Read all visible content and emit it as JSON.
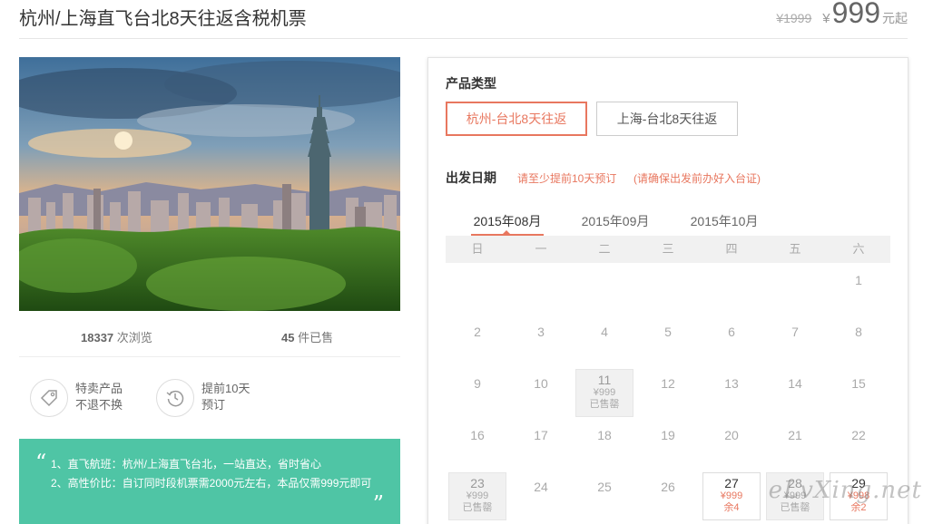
{
  "product": {
    "title": "杭州/上海直飞台北8天往返含税机票",
    "old_price": "¥1999",
    "currency": "¥",
    "price": "999",
    "price_suffix": "元起"
  },
  "stats": {
    "views_count": "18337",
    "views_label": "次浏览",
    "sold_count": "45",
    "sold_label": "件已售"
  },
  "features": [
    {
      "icon": "tag-icon",
      "text": "特卖产品不退不换"
    },
    {
      "icon": "clock-history-icon",
      "text": "提前10天预订"
    }
  ],
  "highlights": {
    "open_quote": "“",
    "close_quote": "”",
    "line1": "1、直飞航班：杭州/上海直飞台北，一站直达，省时省心",
    "line2": "2、高性价比：自订同时段机票需2000元左右，本品仅需999元即可"
  },
  "booking": {
    "type_label": "产品类型",
    "types": [
      "杭州-台北8天往返",
      "上海-台北8天往返"
    ],
    "selected_type": 0,
    "date_label": "出发日期",
    "hint1": "请至少提前10天预订",
    "hint2": "(请确保出发前办好入台证)",
    "months": [
      "2015年08月",
      "2015年09月",
      "2015年10月"
    ],
    "selected_month": 0,
    "weekdays": [
      "日",
      "一",
      "二",
      "三",
      "四",
      "五",
      "六"
    ],
    "calendar": [
      {
        "day": "1",
        "col": 6,
        "row": 0
      },
      {
        "day": "2",
        "col": 0,
        "row": 1
      },
      {
        "day": "3",
        "col": 1,
        "row": 1
      },
      {
        "day": "4",
        "col": 2,
        "row": 1
      },
      {
        "day": "5",
        "col": 3,
        "row": 1
      },
      {
        "day": "6",
        "col": 4,
        "row": 1
      },
      {
        "day": "7",
        "col": 5,
        "row": 1
      },
      {
        "day": "8",
        "col": 6,
        "row": 1
      },
      {
        "day": "9",
        "col": 0,
        "row": 2
      },
      {
        "day": "10",
        "col": 1,
        "row": 2
      },
      {
        "day": "11",
        "col": 2,
        "row": 2,
        "state": "sold",
        "price": "¥999",
        "status": "已售罄"
      },
      {
        "day": "12",
        "col": 3,
        "row": 2
      },
      {
        "day": "13",
        "col": 4,
        "row": 2
      },
      {
        "day": "14",
        "col": 5,
        "row": 2
      },
      {
        "day": "15",
        "col": 6,
        "row": 2
      },
      {
        "day": "16",
        "col": 0,
        "row": 3
      },
      {
        "day": "17",
        "col": 1,
        "row": 3
      },
      {
        "day": "18",
        "col": 2,
        "row": 3
      },
      {
        "day": "19",
        "col": 3,
        "row": 3
      },
      {
        "day": "20",
        "col": 4,
        "row": 3
      },
      {
        "day": "21",
        "col": 5,
        "row": 3
      },
      {
        "day": "22",
        "col": 6,
        "row": 3
      },
      {
        "day": "23",
        "col": 0,
        "row": 4,
        "state": "sold",
        "price": "¥999",
        "status": "已售罄"
      },
      {
        "day": "24",
        "col": 1,
        "row": 4
      },
      {
        "day": "25",
        "col": 2,
        "row": 4
      },
      {
        "day": "26",
        "col": 3,
        "row": 4
      },
      {
        "day": "27",
        "col": 4,
        "row": 4,
        "state": "avail",
        "price": "¥999",
        "status": "余4"
      },
      {
        "day": "28",
        "col": 5,
        "row": 4,
        "state": "sold",
        "price": "¥999",
        "status": "已售罄"
      },
      {
        "day": "29",
        "col": 6,
        "row": 4,
        "state": "avail",
        "price": "¥998",
        "status": "余2"
      }
    ]
  },
  "watermark": "eLvXing.net",
  "colors": {
    "accent": "#e8775f",
    "green": "#4fc5a5"
  }
}
